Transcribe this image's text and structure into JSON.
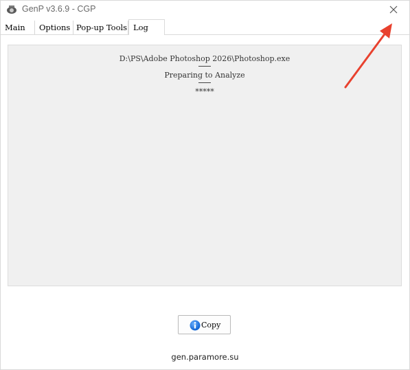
{
  "window": {
    "title": "GenP v3.6.9 - CGP"
  },
  "tabs": [
    {
      "label": "Main"
    },
    {
      "label": "Options"
    },
    {
      "label": "Pop-up Tools"
    },
    {
      "label": "Log"
    }
  ],
  "log": {
    "lines": [
      "D:\\PS\\Adobe Photoshop 2026\\Photoshop.exe",
      "Preparing to Analyze",
      "*****"
    ]
  },
  "copy_button": {
    "label": "Copy",
    "icon": "info-icon"
  },
  "footer": {
    "link_text": "gen.paramore.su"
  },
  "annotation": {
    "arrow_color": "#e8412e"
  }
}
